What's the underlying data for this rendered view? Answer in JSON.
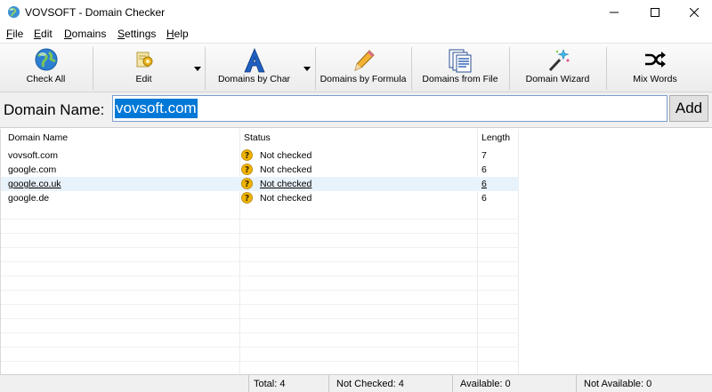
{
  "window": {
    "title": "VOVSOFT - Domain Checker"
  },
  "menu": {
    "items": [
      {
        "hotkey": "F",
        "rest": "ile"
      },
      {
        "hotkey": "E",
        "rest": "dit"
      },
      {
        "hotkey": "D",
        "rest": "omains"
      },
      {
        "hotkey": "S",
        "rest": "ettings"
      },
      {
        "hotkey": "H",
        "rest": "elp"
      }
    ]
  },
  "toolbar": {
    "check_all": "Check All",
    "edit": "Edit",
    "domains_by_char": "Domains by Char",
    "domains_by_formula": "Domains by Formula",
    "domains_from_file": "Domains from File",
    "domain_wizard": "Domain Wizard",
    "mix_words": "Mix Words"
  },
  "domain_entry": {
    "label": "Domain Name:",
    "value": "vovsoft.com",
    "add_label": "Add"
  },
  "grid": {
    "columns": [
      "Domain Name",
      "Status",
      "Length"
    ],
    "rows": [
      {
        "domain": "vovsoft.com",
        "status": "Not checked",
        "length": "7"
      },
      {
        "domain": "google.com",
        "status": "Not checked",
        "length": "6"
      },
      {
        "domain": "google.co.uk",
        "status": "Not checked",
        "length": "6"
      },
      {
        "domain": "google.de",
        "status": "Not checked",
        "length": "6"
      }
    ]
  },
  "statusbar": {
    "total": "Total: 4",
    "not_checked": "Not Checked: 4",
    "available": "Available: 0",
    "not_available": "Not Available: 0"
  },
  "colors": {
    "selection": "#0078d7",
    "status_icon": "#f0b400"
  }
}
